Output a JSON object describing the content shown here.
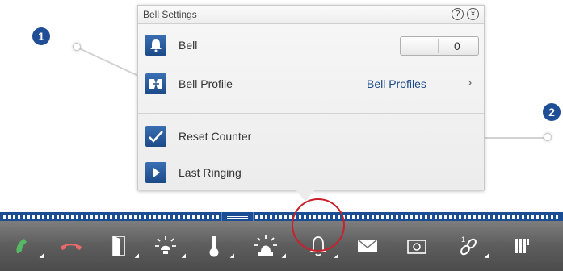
{
  "callouts": [
    {
      "number": "1"
    },
    {
      "number": "2"
    }
  ],
  "popup": {
    "title": "Bell Settings",
    "help_icon": "question-circle-icon",
    "close_icon": "close-circle-icon",
    "rows": [
      {
        "label": "Bell",
        "icon": "bell-icon",
        "control": {
          "type": "toggle",
          "value": "0"
        }
      },
      {
        "label": "Bell Profile",
        "icon": "bell-profile-icon",
        "link": {
          "label": "Bell Profiles",
          "chevron": "›"
        }
      },
      {
        "label": "Reset Counter",
        "icon": "checkmark-icon"
      },
      {
        "label": "Last Ringing",
        "icon": "play-icon"
      }
    ]
  },
  "toolbar": {
    "buttons": [
      {
        "icon": "phone-accept-icon",
        "color": "#4caf50"
      },
      {
        "icon": "phone-hangup-icon",
        "color": "#e35a5a"
      },
      {
        "icon": "door-open-icon"
      },
      {
        "icon": "light-icon"
      },
      {
        "icon": "thermometer-icon"
      },
      {
        "icon": "alarm-light-icon"
      },
      {
        "icon": "bell-icon",
        "selected": true
      },
      {
        "icon": "mail-icon"
      },
      {
        "icon": "camera-icon"
      },
      {
        "icon": "link-icon"
      },
      {
        "icon": "bars-icon"
      }
    ]
  },
  "colors": {
    "accent": "#1f4e96",
    "highlight": "#c9202a",
    "link": "#1d4a8a"
  }
}
